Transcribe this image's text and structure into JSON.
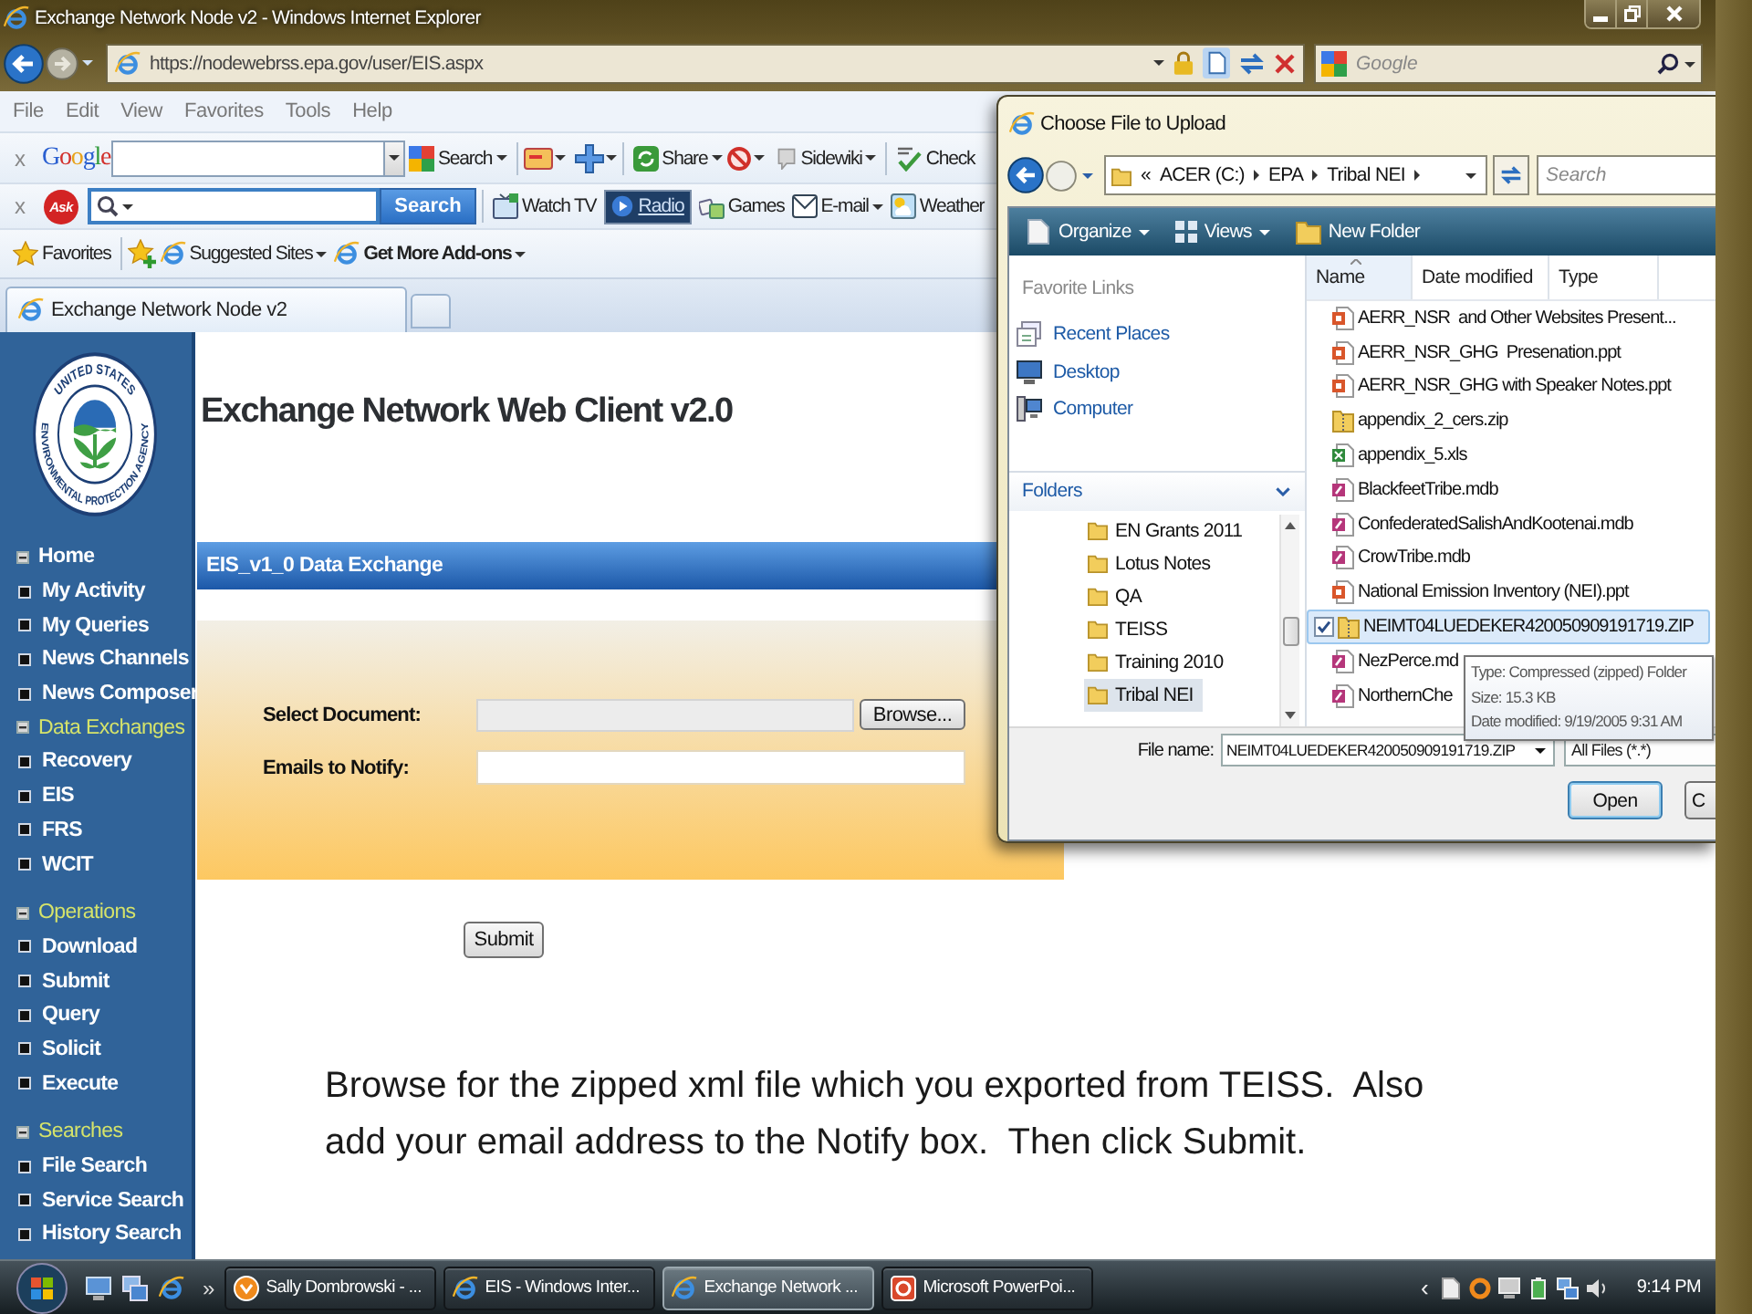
{
  "window": {
    "title": "Exchange Network Node v2 - Windows Internet Explorer"
  },
  "address_bar": {
    "url": "https://nodewebrss.epa.gov/user/EIS.aspx",
    "search_placeholder": "Google"
  },
  "menu": [
    "File",
    "Edit",
    "View",
    "Favorites",
    "Tools",
    "Help"
  ],
  "google_toolbar": {
    "close": "x",
    "logo": "Google",
    "search": "Search",
    "share": "Share",
    "sidewiki": "Sidewiki",
    "check": "Check"
  },
  "ask_toolbar": {
    "close": "x",
    "logo": "Ask",
    "search": "Search",
    "watch_tv": "Watch TV",
    "radio": {
      "label": "Radio",
      "on": true
    },
    "games": "Games",
    "email": "E-mail",
    "weather": "Weather"
  },
  "favorites_bar": {
    "favorites": "Favorites",
    "suggested": "Suggested Sites",
    "addons": "Get More Add-ons"
  },
  "tabs": [
    {
      "label": "Exchange Network Node v2",
      "selected": true
    }
  ],
  "sidebar": {
    "seal_top": "UNITED STATES",
    "seal_bottom": "ENVIRONMENTAL PROTECTION AGENCY",
    "nav": [
      {
        "label": "Home",
        "kind": "link",
        "children": [
          {
            "label": "My Activity"
          },
          {
            "label": "My Queries"
          },
          {
            "label": "News Channels"
          },
          {
            "label": "News Composer"
          }
        ]
      },
      {
        "label": "Data Exchanges",
        "kind": "section",
        "children": [
          {
            "label": "Recovery"
          },
          {
            "label": "EIS"
          },
          {
            "label": "FRS"
          },
          {
            "label": "WCIT"
          }
        ]
      },
      {
        "label": "Operations",
        "kind": "section",
        "children": [
          {
            "label": "Download"
          },
          {
            "label": "Submit"
          },
          {
            "label": "Query"
          },
          {
            "label": "Solicit"
          },
          {
            "label": "Execute"
          }
        ]
      },
      {
        "label": "Searches",
        "kind": "section",
        "children": [
          {
            "label": "File Search"
          },
          {
            "label": "Service Search"
          },
          {
            "label": "History Search"
          }
        ]
      }
    ]
  },
  "page": {
    "heading": "Exchange Network Web Client v2.0",
    "section_title": "EIS_v1_0 Data Exchange",
    "fields": [
      {
        "label": "Select Document:",
        "kind": "file",
        "button": "Browse..."
      },
      {
        "label": "Emails to Notify:",
        "kind": "text"
      }
    ],
    "submit": "Submit"
  },
  "caption": {
    "lines": [
      "Browse for the zipped xml file which you exported from TEISS.  Also",
      "add your email address to the Notify box.  Then click Submit."
    ]
  },
  "dialog": {
    "title": "Choose File to Upload",
    "path_overflow": "«",
    "path": [
      "ACER (C:)",
      "EPA",
      "Tribal NEI"
    ],
    "search_placeholder": "Search",
    "toolbar": [
      {
        "label": "Organize",
        "kind": "organize"
      },
      {
        "label": "Views",
        "kind": "views"
      },
      {
        "label": "New Folder",
        "kind": "new_folder"
      }
    ],
    "favorite_links": {
      "title": "Favorite Links",
      "items": [
        {
          "label": "Recent Places",
          "kind": "recent"
        },
        {
          "label": "Desktop",
          "kind": "desktop"
        },
        {
          "label": "Computer",
          "kind": "computer"
        }
      ]
    },
    "folders": {
      "title": "Folders",
      "items": [
        {
          "label": "EN Grants 2011",
          "selected": false
        },
        {
          "label": "Lotus Notes",
          "selected": false
        },
        {
          "label": "QA",
          "selected": false
        },
        {
          "label": "TEISS",
          "selected": false
        },
        {
          "label": "Training 2010",
          "selected": false
        },
        {
          "label": "Tribal NEI",
          "selected": true
        }
      ]
    },
    "columns": [
      "Name",
      "Date modified",
      "Type"
    ],
    "files": [
      {
        "name": "AERR_NSR  and Other Websites Present...",
        "kind": "ppt",
        "selected": false
      },
      {
        "name": "AERR_NSR_GHG  Presenation.ppt",
        "kind": "ppt",
        "selected": false
      },
      {
        "name": "AERR_NSR_GHG with Speaker Notes.ppt",
        "kind": "ppt",
        "selected": false
      },
      {
        "name": "appendix_2_cers.zip",
        "kind": "zip",
        "selected": false
      },
      {
        "name": "appendix_5.xls",
        "kind": "xls",
        "selected": false
      },
      {
        "name": "BlackfeetTribe.mdb",
        "kind": "mdb",
        "selected": false
      },
      {
        "name": "ConfederatedSalishAndKootenai.mdb",
        "kind": "mdb",
        "selected": false
      },
      {
        "name": "CrowTribe.mdb",
        "kind": "mdb",
        "selected": false
      },
      {
        "name": "National Emission Inventory (NEI).ppt",
        "kind": "ppt",
        "selected": false
      },
      {
        "name": "NEIMT04LUEDEKER420050909191719.ZIP",
        "kind": "zip",
        "selected": true
      },
      {
        "name": "NezPerce.md",
        "kind": "mdb",
        "selected": false
      },
      {
        "name": "NorthernChe",
        "kind": "mdb",
        "selected": false
      }
    ],
    "tooltip": [
      "Type: Compressed (zipped) Folder",
      "Size: 15.3 KB",
      "Date modified: 9/19/2005 9:31 AM"
    ],
    "file_name": {
      "label": "File name:",
      "value": "NEIMT04LUEDEKER420050909191719.ZIP"
    },
    "filter": "All Files (*.*)",
    "buttons": [
      {
        "label": "Open",
        "default": true
      },
      {
        "label": "C",
        "default": false
      }
    ]
  },
  "taskbar": {
    "more": "»",
    "tasks": [
      {
        "label": "Sally Dombrowski - ...",
        "kind": "mail",
        "selected": false
      },
      {
        "label": "EIS - Windows Inter...",
        "kind": "browser",
        "selected": false
      },
      {
        "label": "Exchange Network ...",
        "kind": "browser",
        "selected": true
      },
      {
        "label": "Microsoft PowerPoi...",
        "kind": "slides",
        "selected": false
      }
    ],
    "tray_arrow": "‹",
    "clock": "9:14 PM"
  }
}
